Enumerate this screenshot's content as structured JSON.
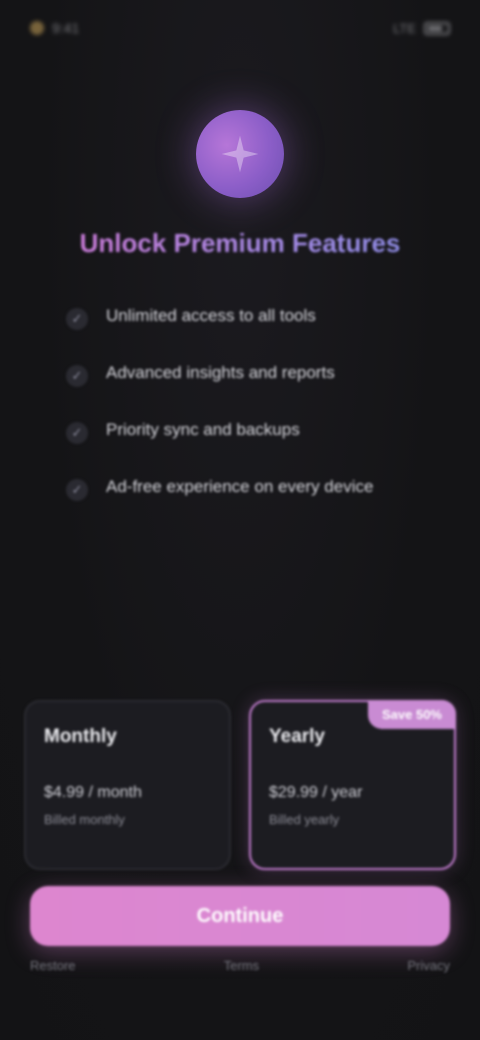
{
  "status_bar": {
    "time": "9:41",
    "signal": "LTE"
  },
  "hero": {
    "icon": "sparkle-icon",
    "title": "Unlock Premium Features"
  },
  "features": [
    {
      "icon": "check-icon",
      "text": "Unlimited access to all tools"
    },
    {
      "icon": "check-icon",
      "text": "Advanced insights and reports"
    },
    {
      "icon": "check-icon",
      "text": "Priority sync and backups"
    },
    {
      "icon": "check-icon",
      "text": "Ad-free experience on every device"
    }
  ],
  "plans": [
    {
      "name": "Monthly",
      "price": "$4.99 / month",
      "note": "Billed monthly",
      "tag": "",
      "selected": false
    },
    {
      "name": "Yearly",
      "price": "$29.99 / year",
      "note": "Billed yearly",
      "tag": "Save 50%",
      "selected": true
    }
  ],
  "cta": {
    "label": "Continue"
  },
  "footer": {
    "restore": "Restore",
    "terms": "Terms",
    "privacy": "Privacy"
  },
  "colors": {
    "accent": "#d688d4",
    "background": "#141416",
    "card": "#1c1c21"
  }
}
